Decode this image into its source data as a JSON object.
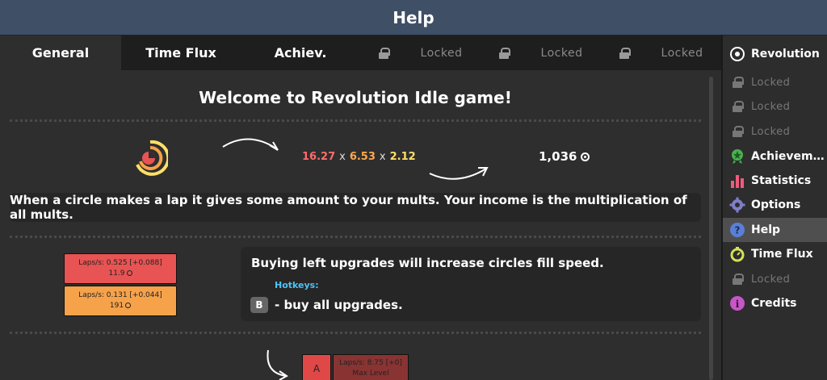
{
  "header": {
    "title": "Help"
  },
  "tabs": [
    {
      "label": "General",
      "active": true
    },
    {
      "label": "Time Flux"
    },
    {
      "label": "Achiev."
    },
    {
      "label": "Locked",
      "locked": true
    },
    {
      "label": "Locked",
      "locked": true
    },
    {
      "label": "Locked",
      "locked": true
    }
  ],
  "main": {
    "welcome": "Welcome to Revolution Idle game!",
    "mults": [
      "16.27",
      "6.53",
      "2.12"
    ],
    "mult_sep": "x",
    "total": "1,036",
    "explain": "When a circle makes a lap it gives some amount to your mults. Your income is the multiplication of all mults.",
    "upgrades": [
      {
        "line1": "Laps/s: 0.525 [+0.088]",
        "line2": "11.9",
        "color": "#e85353"
      },
      {
        "line1": "Laps/s: 0.131 [+0.044]",
        "line2": "191",
        "color": "#f5a24a"
      }
    ],
    "info_text": "Buying left upgrades will increase circles fill speed.",
    "hotkeys_label": "Hotkeys:",
    "hotkey_key": "B",
    "hotkey_text": "- buy all upgrades.",
    "bottom_key": "A",
    "bottom_line1": "Laps/s: 8.75 [+0]",
    "bottom_line2": "Max Level"
  },
  "sidebar": {
    "items": [
      {
        "label": "Revolution",
        "icon": "revolution-icon"
      },
      {
        "label": "Locked",
        "icon": "lock-icon",
        "locked": true
      },
      {
        "label": "Locked",
        "icon": "lock-icon",
        "locked": true
      },
      {
        "label": "Locked",
        "icon": "lock-icon",
        "locked": true
      },
      {
        "label": "Achievem…",
        "icon": "achievement-icon"
      },
      {
        "label": "Statistics",
        "icon": "statistics-icon"
      },
      {
        "label": "Options",
        "icon": "gear-icon"
      },
      {
        "label": "Help",
        "icon": "help-icon",
        "active": true
      },
      {
        "label": "Time Flux",
        "icon": "stopwatch-icon"
      },
      {
        "label": "Locked",
        "icon": "lock-icon",
        "locked": true
      },
      {
        "label": "Credits",
        "icon": "info-icon"
      }
    ]
  },
  "colors": {
    "header": "#3e4f66",
    "accent_red": "#e85353",
    "accent_orange": "#f5a24a",
    "accent_yellow": "#ffe066",
    "hotkey_blue": "#4fc3f7"
  }
}
